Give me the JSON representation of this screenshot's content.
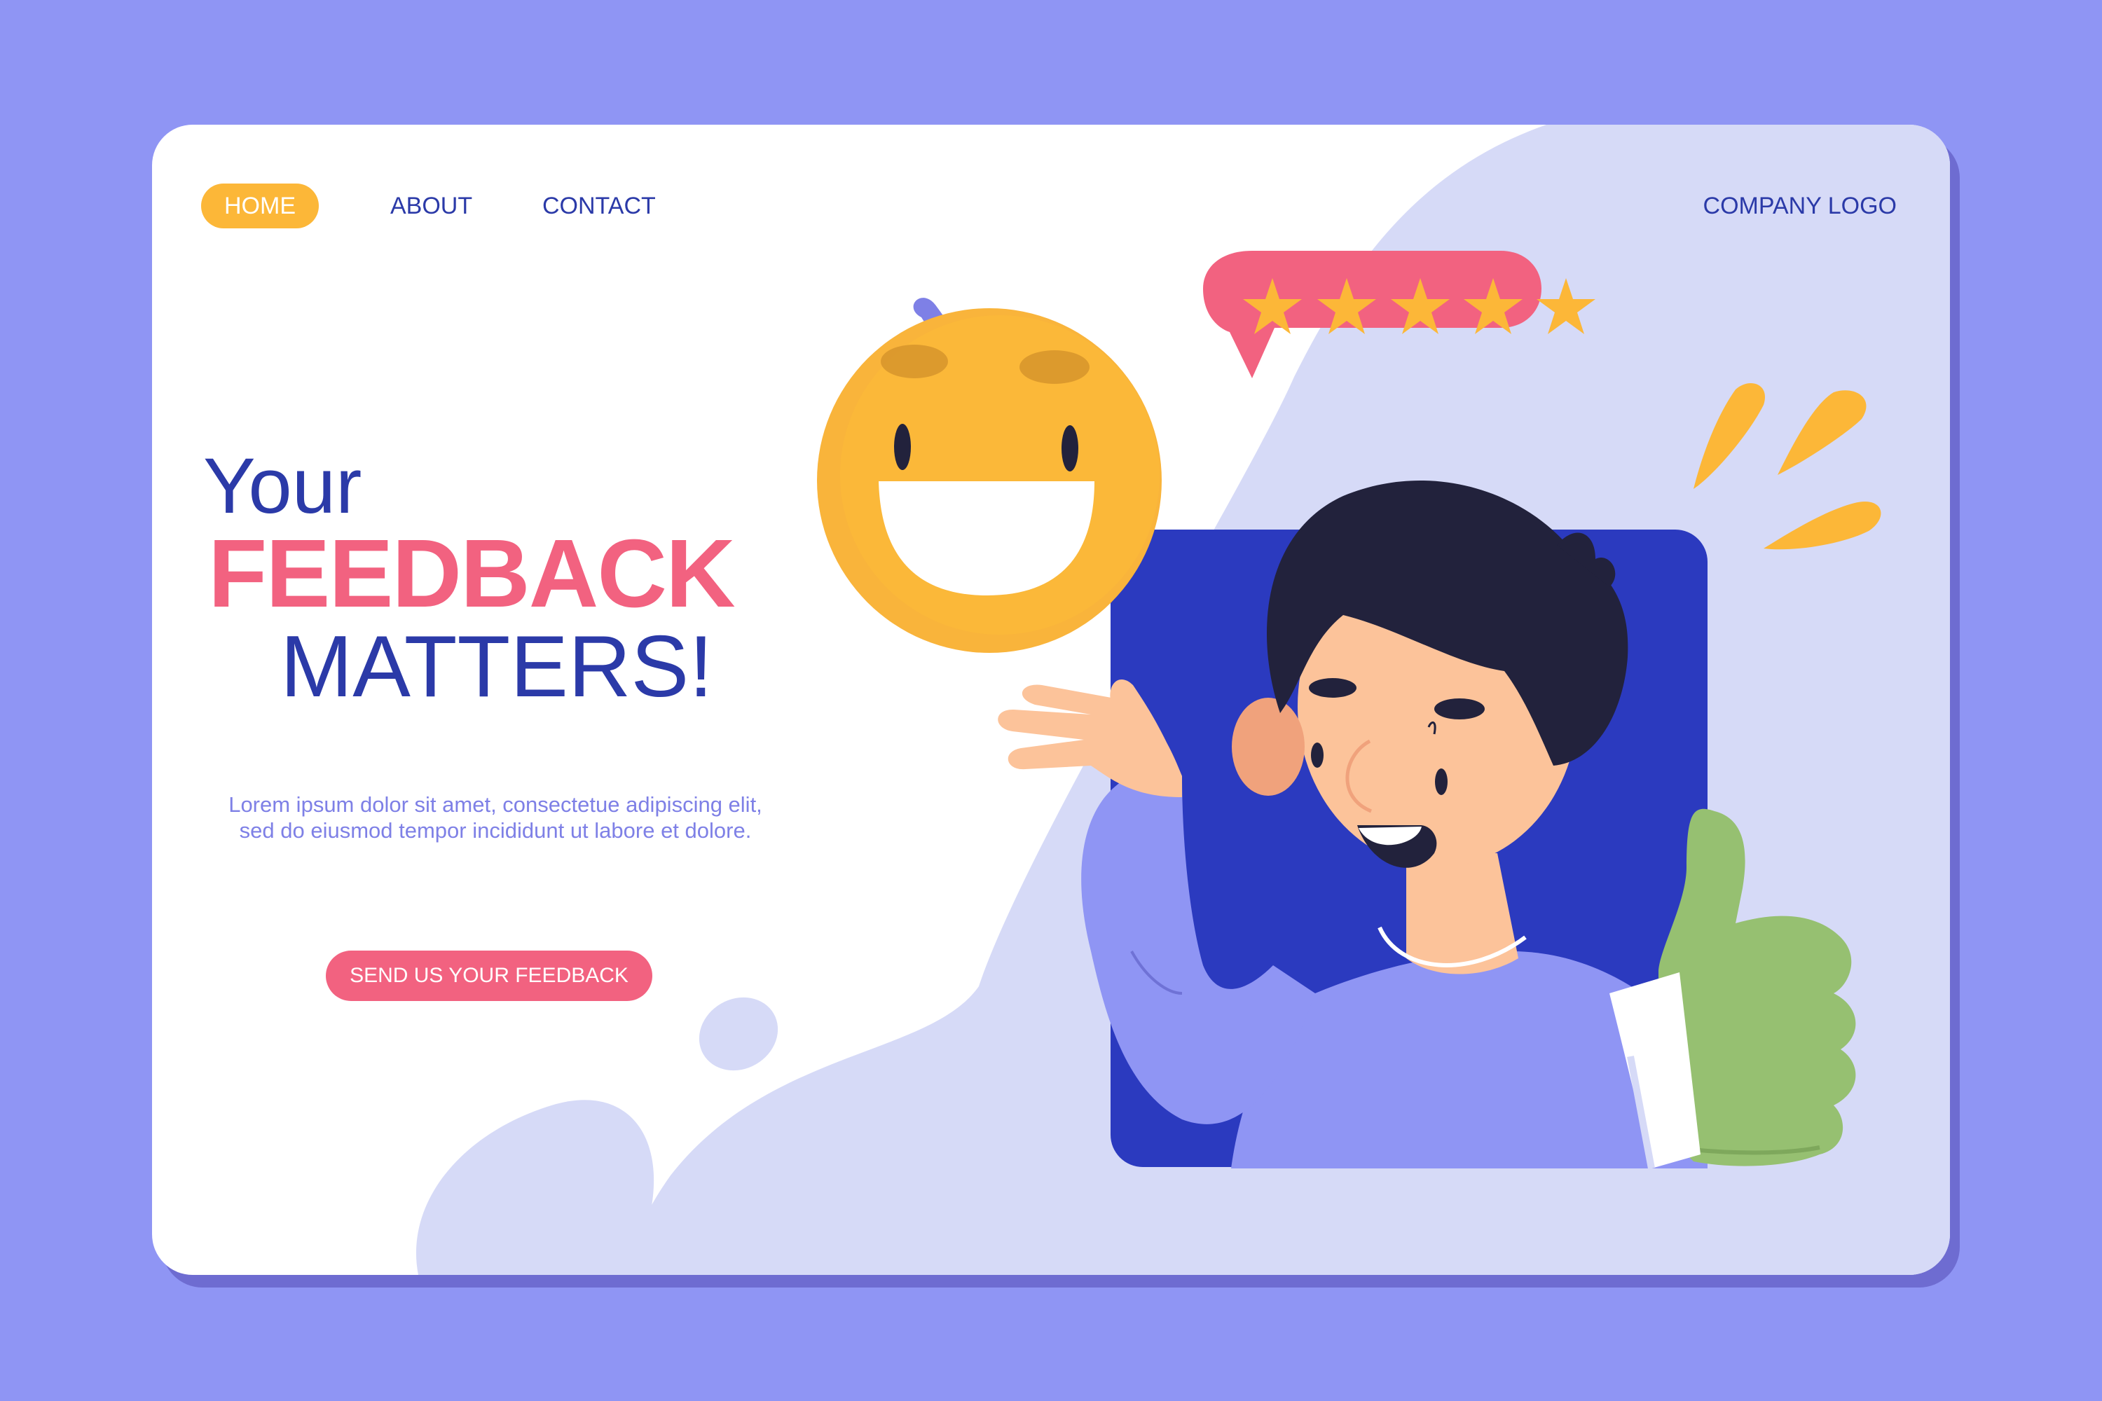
{
  "nav": {
    "home_label": "HOME",
    "about_label": "ABOUT",
    "contact_label": "CONTACT",
    "company_logo": "COMPANY LOGO"
  },
  "hero": {
    "title_line1": "Your",
    "title_line2": "FEEDBACK",
    "title_line3": "MATTERS!",
    "description": "Lorem ipsum dolor sit amet, consectetue adipiscing elit, sed do eiusmod tempor incididunt ut labore et dolore.",
    "cta_label": "SEND US YOUR FEEDBACK"
  },
  "rating": {
    "stars": 5,
    "max": 5
  },
  "colors": {
    "page_background": "#8f95f4",
    "card_background": "#ffffff",
    "accent_blue": "#2b3aa8",
    "accent_pink": "#f26280",
    "accent_yellow": "#fcb738",
    "lavender": "#d6daf7",
    "thumb_green": "#96c071"
  },
  "icons": [
    "smiley-emoji-icon",
    "star-icon",
    "thumbs-up-icon",
    "speech-bubble-icon"
  ]
}
